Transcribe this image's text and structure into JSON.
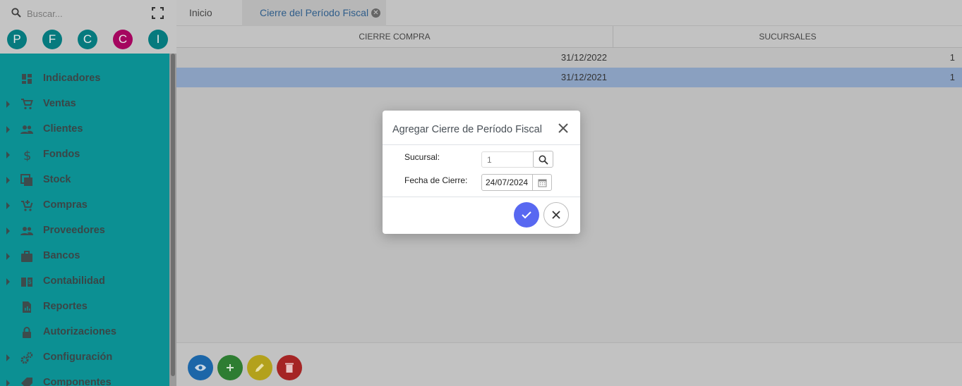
{
  "search": {
    "placeholder": "Buscar..."
  },
  "avatars": [
    "P",
    "F",
    "C",
    "C",
    "I"
  ],
  "menu": [
    {
      "label": "Indicadores",
      "icon": "dashboard-icon",
      "expandable": false
    },
    {
      "label": "Ventas",
      "icon": "cart-icon",
      "expandable": true
    },
    {
      "label": "Clientes",
      "icon": "people-icon",
      "expandable": true
    },
    {
      "label": "Fondos",
      "icon": "dollar-icon",
      "expandable": true
    },
    {
      "label": "Stock",
      "icon": "stock-icon",
      "expandable": true
    },
    {
      "label": "Compras",
      "icon": "cart-add-icon",
      "expandable": true
    },
    {
      "label": "Proveedores",
      "icon": "people-icon",
      "expandable": true
    },
    {
      "label": "Bancos",
      "icon": "briefcase-icon",
      "expandable": true
    },
    {
      "label": "Contabilidad",
      "icon": "ledger-icon",
      "expandable": true
    },
    {
      "label": "Reportes",
      "icon": "report-icon",
      "expandable": false
    },
    {
      "label": "Autorizaciones",
      "icon": "lock-icon",
      "expandable": false
    },
    {
      "label": "Configuración",
      "icon": "settings-icon",
      "expandable": true
    },
    {
      "label": "Componentes",
      "icon": "tag-icon",
      "expandable": true
    }
  ],
  "tabs": {
    "home": "Inicio",
    "active": "Cierre del Período Fiscal"
  },
  "table": {
    "headers": {
      "cierre": "CIERRE COMPRA",
      "sucursales": "SUCURSALES"
    },
    "rows": [
      {
        "fecha": "31/12/2022",
        "sucursal": "1",
        "selected": false
      },
      {
        "fecha": "31/12/2021",
        "sucursal": "1",
        "selected": true
      }
    ]
  },
  "dialog": {
    "title": "Agregar Cierre de Período Fiscal",
    "sucursal_label": "Sucursal:",
    "sucursal_placeholder": "1",
    "fecha_label": "Fecha de Cierre:",
    "fecha_value": "24/07/2024"
  },
  "colors": {
    "menu_bg": "#0c9093",
    "accent": "#5868f1",
    "selected_row": "#8aa0c0"
  }
}
